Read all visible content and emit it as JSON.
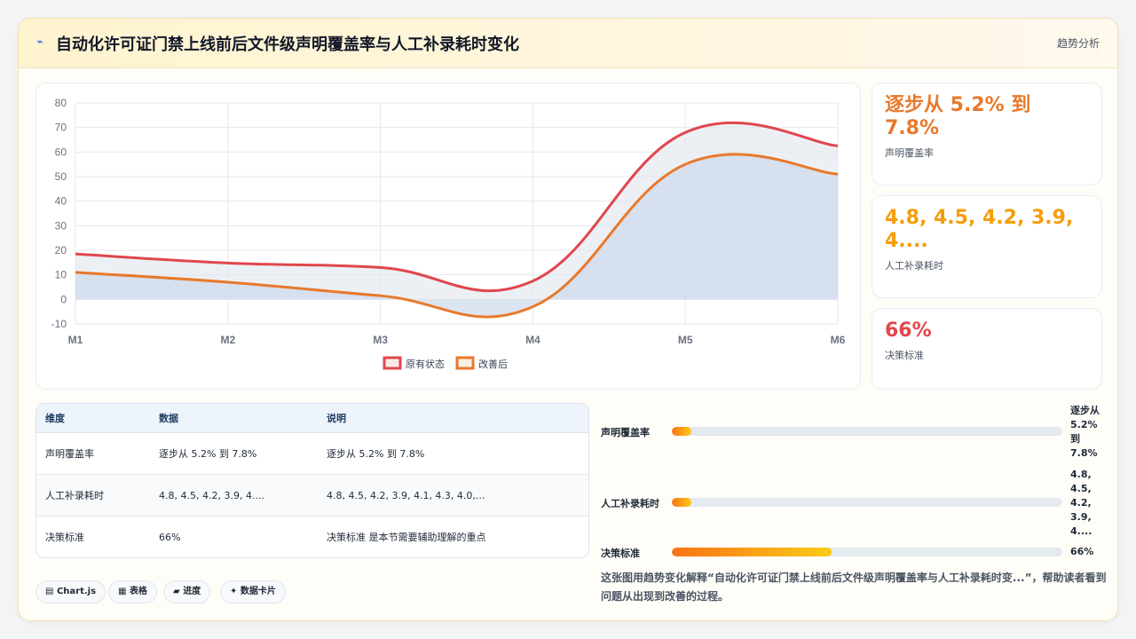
{
  "header": {
    "icon": "trend-icon",
    "title": "自动化许可证门禁上线前后文件级声明覆盖率与人工补录耗时变化",
    "tag": "趋势分析"
  },
  "chart_data": {
    "type": "line",
    "categories": [
      "M1",
      "M2",
      "M3",
      "M4",
      "M5",
      "M6"
    ],
    "ylim": [
      -10,
      80
    ],
    "yticks": [
      "80",
      "70",
      "60",
      "50",
      "40",
      "30",
      "20",
      "10",
      "0",
      "-10"
    ],
    "grid": true,
    "legend_position": "bottom",
    "series": [
      {
        "name": "原有状态",
        "color": "#e0474c",
        "values": [
          18.5,
          14.8,
          13.0,
          7.5,
          68.0,
          62.5
        ]
      },
      {
        "name": "改善后",
        "color": "#e8792b",
        "values": [
          11.0,
          7.0,
          1.5,
          -3.0,
          55.0,
          51.0
        ]
      }
    ]
  },
  "kpis": [
    {
      "value": "逐步从 5.2% 到 7.8%",
      "label": "声明覆盖率",
      "color": "#e8792b"
    },
    {
      "value": "4.8, 4.5, 4.2, 3.9, 4....",
      "label": "人工补录耗时",
      "color": "#f59e0b"
    },
    {
      "value": "66%",
      "label": "决策标准",
      "color": "#e0474c"
    }
  ],
  "table": {
    "headers": [
      "维度",
      "数据",
      "说明"
    ],
    "rows": [
      [
        "声明覆盖率",
        "逐步从 5.2% 到 7.8%",
        "逐步从 5.2% 到 7.8%"
      ],
      [
        "人工补录耗时",
        "4.8, 4.5, 4.2, 3.9, 4....",
        "4.8, 4.5, 4.2, 3.9, 4.1, 4.3, 4.0,..."
      ],
      [
        "决策标准",
        "66%",
        "决策标准 是本节需要辅助理解的重点"
      ]
    ]
  },
  "chips": [
    {
      "icon": "chart-icon",
      "glyph": "▤",
      "label": "Chart.js"
    },
    {
      "icon": "table-icon",
      "glyph": "▦",
      "label": "表格"
    },
    {
      "icon": "progress-icon",
      "glyph": "▰",
      "label": "进度"
    },
    {
      "icon": "card-icon",
      "glyph": "✦",
      "label": "数据卡片"
    }
  ],
  "progress": [
    {
      "label": "声明覆盖率",
      "value": "逐步从 5.2% 到 7.8%",
      "fraction": 0.05
    },
    {
      "label": "人工补录耗时",
      "value": "4.8, 4.5, 4.2, 3.9, 4....",
      "fraction": 0.05
    },
    {
      "label": "决策标准",
      "value": "66%",
      "fraction": 0.41
    }
  ],
  "description": "这张图用趋势变化解释“自动化许可证门禁上线前后文件级声明覆盖率与人工补录耗时变...”，帮助读者看到问题从出现到改善的过程。"
}
